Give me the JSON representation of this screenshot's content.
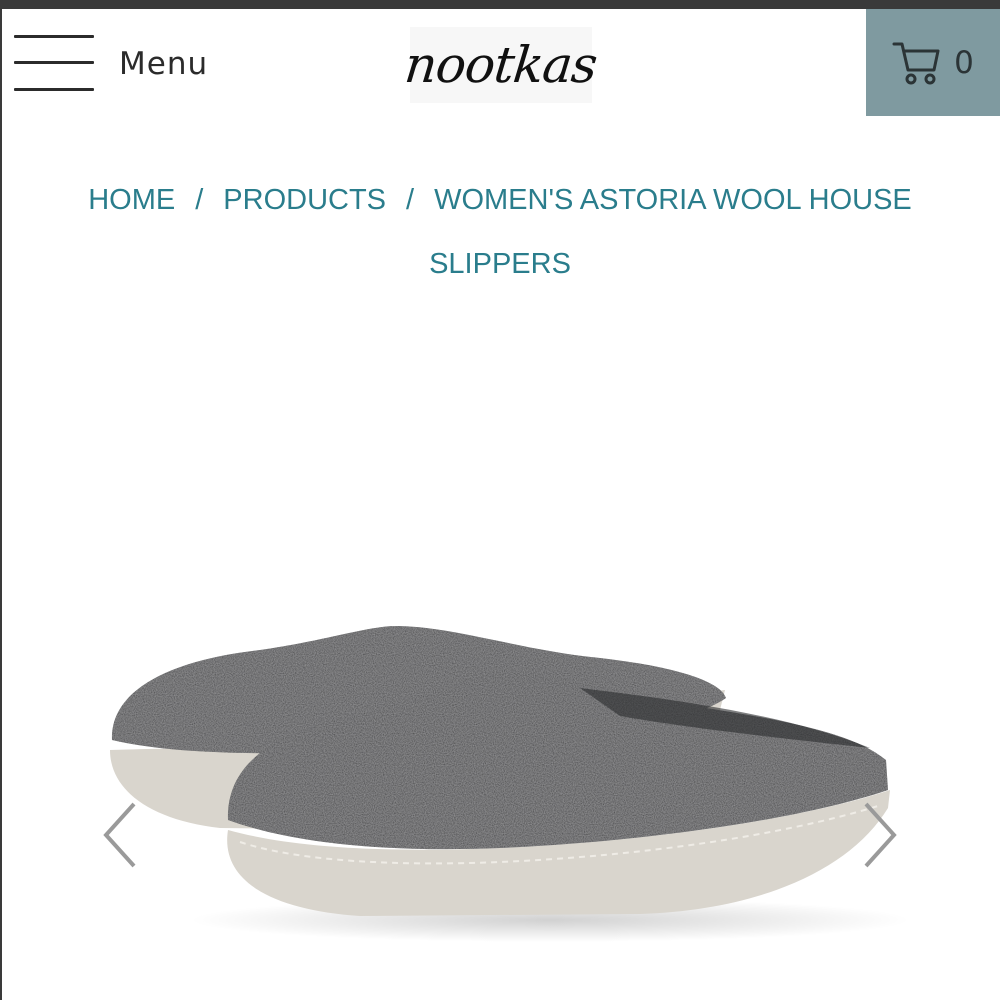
{
  "header": {
    "menu_label": "Menu",
    "logo_text": "nootkas",
    "cart_count": "0"
  },
  "breadcrumb": {
    "home": "HOME",
    "products": "PRODUCTS",
    "current": "WOMEN'S ASTORIA WOOL HOUSE SLIPPERS",
    "separator": "/"
  },
  "product": {
    "image": "charcoal-felted-wool-slippers-photo",
    "wool_color": "#3a3b3d",
    "sole_color": "#d9d5cd"
  },
  "carousel": {
    "prev_icon": "chevron-left-icon",
    "next_icon": "chevron-right-icon"
  },
  "colors": {
    "link": "#2a7d8c",
    "cart_bg": "#7f9aa0",
    "top_strip": "#3a3a3a"
  }
}
